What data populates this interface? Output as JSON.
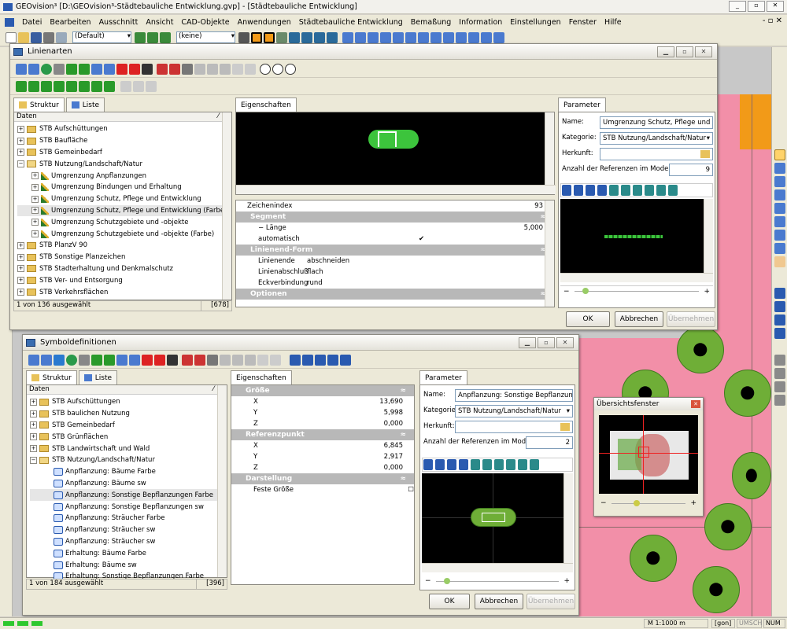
{
  "app": {
    "title": "GEOvision³ [D:\\GEOvision³-Städtebauliche Entwicklung.gvp] - [Städtebauliche Entwicklung]"
  },
  "menu": [
    "Datei",
    "Bearbeiten",
    "Ausschnitt",
    "Ansicht",
    "CAD-Objekte",
    "Anwendungen",
    "Städtebauliche Entwicklung",
    "Bemaßung",
    "Information",
    "Einstellungen",
    "Fenster",
    "Hilfe"
  ],
  "toolbar": {
    "style_select": "(Default)",
    "layer_select": "(keine)"
  },
  "linienarten": {
    "title": "Linienarten",
    "tabs": {
      "struktur": "Struktur",
      "liste": "Liste"
    },
    "tree_header": "Daten",
    "tree": [
      {
        "label": "STB Aufschüttungen",
        "depth": 0,
        "exp": "+",
        "type": "folder"
      },
      {
        "label": "STB Baufläche",
        "depth": 0,
        "exp": "+",
        "type": "folder"
      },
      {
        "label": "STB Gemeinbedarf",
        "depth": 0,
        "exp": "+",
        "type": "folder"
      },
      {
        "label": "STB Nutzung/Landschaft/Natur",
        "depth": 0,
        "exp": "−",
        "type": "folder-open"
      },
      {
        "label": "Umgrenzung Anpflanzungen",
        "depth": 1,
        "exp": "+",
        "type": "pen"
      },
      {
        "label": "Umgrenzung Bindungen und Erhaltung",
        "depth": 1,
        "exp": "+",
        "type": "pen"
      },
      {
        "label": "Umgrenzung Schutz, Pflege und Entwicklung",
        "depth": 1,
        "exp": "+",
        "type": "pen"
      },
      {
        "label": "Umgrenzung Schutz, Pflege und Entwicklung (Farbe)",
        "depth": 1,
        "exp": "+",
        "type": "pen",
        "selected": true
      },
      {
        "label": "Umgrenzung Schutzgebiete und -objekte",
        "depth": 1,
        "exp": "+",
        "type": "pen"
      },
      {
        "label": "Umgrenzung Schutzgebiete und -objekte (Farbe)",
        "depth": 1,
        "exp": "+",
        "type": "pen"
      },
      {
        "label": "STB PlanzV 90",
        "depth": 0,
        "exp": "+",
        "type": "folder"
      },
      {
        "label": "STB Sonstige Planzeichen",
        "depth": 0,
        "exp": "+",
        "type": "folder"
      },
      {
        "label": "STB Stadterhaltung und Denkmalschutz",
        "depth": 0,
        "exp": "+",
        "type": "folder"
      },
      {
        "label": "STB Ver- und Entsorgung",
        "depth": 0,
        "exp": "+",
        "type": "folder"
      },
      {
        "label": "STB Verkehrsflächen",
        "depth": 0,
        "exp": "+",
        "type": "folder"
      }
    ],
    "status_left": "1 von 136 ausgewählt",
    "status_right": "[678]",
    "props_tab": "Eigenschaften",
    "props": [
      {
        "kind": "row",
        "k": "Zeichenindex",
        "v": "93",
        "top": true
      },
      {
        "kind": "hdr",
        "k": "Segment"
      },
      {
        "kind": "row",
        "k": "− Länge",
        "v": "5,000"
      },
      {
        "kind": "row",
        "k": "automatisch",
        "v": "✔"
      },
      {
        "kind": "hdr",
        "k": "Linienend-Form"
      },
      {
        "kind": "row",
        "k": "Linienende",
        "v": "abschneiden"
      },
      {
        "kind": "row",
        "k": "Linienabschluß",
        "v": "flach"
      },
      {
        "kind": "row",
        "k": "Eckverbindung",
        "v": "rund"
      },
      {
        "kind": "hdr",
        "k": "Optionen"
      }
    ],
    "param_tab": "Parameter",
    "param": {
      "name_label": "Name:",
      "name_value": "Umgrenzung Schutz, Pflege und Entw",
      "kat_label": "Kategorie:",
      "kat_value": "STB Nutzung/Landschaft/Natur",
      "herkunft_label": "Herkunft:",
      "herkunft_value": "",
      "refs_label": "Anzahl der Referenzen im Modell:",
      "refs_value": "9"
    },
    "buttons": {
      "ok": "OK",
      "cancel": "Abbrechen",
      "apply": "Übernehmen"
    }
  },
  "symbol": {
    "title": "Symboldefinitionen",
    "tabs": {
      "struktur": "Struktur",
      "liste": "Liste"
    },
    "tree_header": "Daten",
    "tree": [
      {
        "label": "STB Aufschüttungen",
        "depth": 0,
        "exp": "+",
        "type": "folder"
      },
      {
        "label": "STB baulichen Nutzung",
        "depth": 0,
        "exp": "+",
        "type": "folder"
      },
      {
        "label": "STB Gemeinbedarf",
        "depth": 0,
        "exp": "+",
        "type": "folder"
      },
      {
        "label": "STB Grünflächen",
        "depth": 0,
        "exp": "+",
        "type": "folder"
      },
      {
        "label": "STB Landwirtschaft und Wald",
        "depth": 0,
        "exp": "+",
        "type": "folder"
      },
      {
        "label": "STB Nutzung/Landschaft/Natur",
        "depth": 0,
        "exp": "−",
        "type": "folder-open"
      },
      {
        "label": "Anpflanzung: Bäume Farbe",
        "depth": 1,
        "type": "sym"
      },
      {
        "label": "Anpflanzung: Bäume sw",
        "depth": 1,
        "type": "sym"
      },
      {
        "label": "Anpflanzung: Sonstige Bepflanzungen  Farbe",
        "depth": 1,
        "type": "sym",
        "selected": true
      },
      {
        "label": "Anpflanzung: Sonstige Bepflanzungen sw",
        "depth": 1,
        "type": "sym"
      },
      {
        "label": "Anpflanzung: Sträucher Farbe",
        "depth": 1,
        "type": "sym"
      },
      {
        "label": "Anpflanzung: Sträucher sw",
        "depth": 1,
        "type": "sym"
      },
      {
        "label": "Anpflanzung: Sträucher sw",
        "depth": 1,
        "type": "sym"
      },
      {
        "label": "Erhaltung: Bäume Farbe",
        "depth": 1,
        "type": "sym"
      },
      {
        "label": "Erhaltung: Bäume sw",
        "depth": 1,
        "type": "sym"
      },
      {
        "label": "Erhaltung: Sonstige Bepflanzungen Farbe",
        "depth": 1,
        "type": "sym"
      }
    ],
    "status_left": "1 von 184 ausgewählt",
    "status_right": "[396]",
    "props_tab": "Eigenschaften",
    "props": [
      {
        "kind": "hdr",
        "k": "Größe"
      },
      {
        "kind": "row",
        "k": "X",
        "v": "13,690"
      },
      {
        "kind": "row",
        "k": "Y",
        "v": "5,998"
      },
      {
        "kind": "row",
        "k": "Z",
        "v": "0,000"
      },
      {
        "kind": "hdr",
        "k": "Referenzpunkt"
      },
      {
        "kind": "row",
        "k": "X",
        "v": "6,845"
      },
      {
        "kind": "row",
        "k": "Y",
        "v": "2,917"
      },
      {
        "kind": "row",
        "k": "Z",
        "v": "0,000"
      },
      {
        "kind": "hdr",
        "k": "Darstellung"
      },
      {
        "kind": "row",
        "k": "Feste Größe",
        "v": "☐"
      }
    ],
    "param_tab": "Parameter",
    "param": {
      "name_label": "Name:",
      "name_value": "Anpflanzung: Sonstige Bepflanzungen",
      "kat_label": "Kategorie:",
      "kat_value": "STB Nutzung/Landschaft/Natur",
      "herkunft_label": "Herkunft:",
      "herkunft_value": "",
      "refs_label": "Anzahl der Referenzen im Modell:",
      "refs_value": "2"
    },
    "buttons": {
      "ok": "OK",
      "cancel": "Abbrechen",
      "apply": "Übernehmen"
    }
  },
  "overview": {
    "title": "Übersichtsfenster"
  },
  "status": {
    "scale": "M 1:1000  m",
    "unit": "[gon]",
    "caps": "UMSCH",
    "num": "NUM"
  },
  "colors": {
    "pink": "#f28fa8",
    "tree_green": "#6fae37",
    "title_bar": "#ece9d8"
  }
}
